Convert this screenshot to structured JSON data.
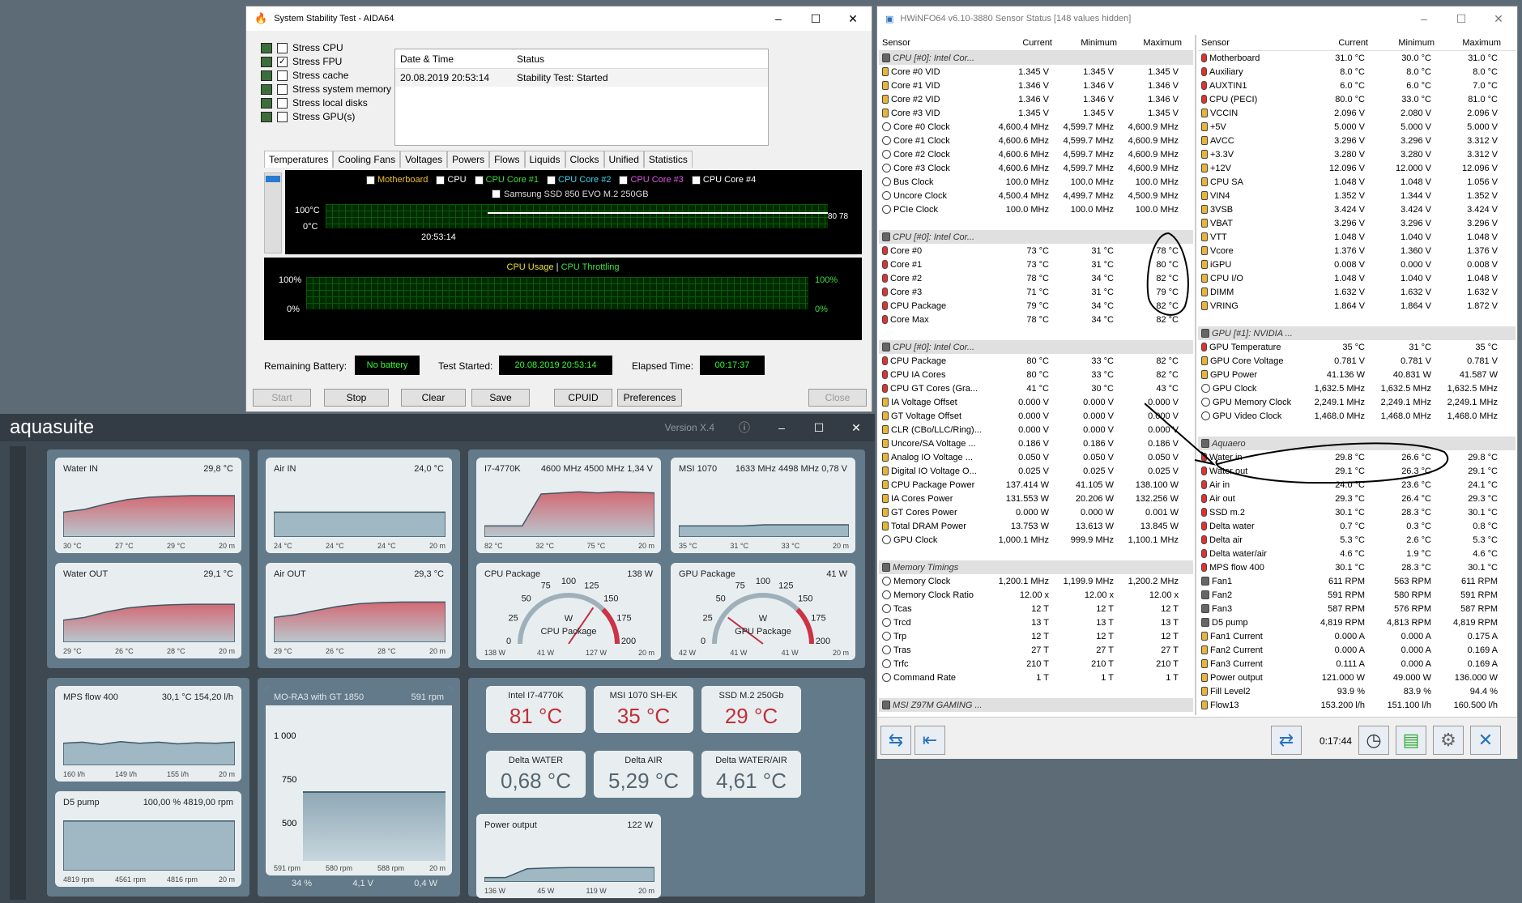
{
  "aida": {
    "title": "System Stability Test - AIDA64",
    "stress": [
      {
        "label": "Stress CPU",
        "checked": false
      },
      {
        "label": "Stress FPU",
        "checked": true
      },
      {
        "label": "Stress cache",
        "checked": false
      },
      {
        "label": "Stress system memory",
        "checked": false
      },
      {
        "label": "Stress local disks",
        "checked": false
      },
      {
        "label": "Stress GPU(s)",
        "checked": false
      }
    ],
    "table": {
      "col1": "Date & Time",
      "col2": "Status",
      "date": "20.08.2019 20:53:14",
      "status": "Stability Test: Started"
    },
    "tabs": [
      "Temperatures",
      "Cooling Fans",
      "Voltages",
      "Powers",
      "Flows",
      "Liquids",
      "Clocks",
      "Unified",
      "Statistics"
    ],
    "legend": [
      "Motherboard",
      "CPU",
      "CPU Core #1",
      "CPU Core #2",
      "CPU Core #3",
      "CPU Core #4"
    ],
    "legend2": "Samsung SSD 850 EVO M.2 250GB",
    "temp_top": "100°C",
    "temp_bottom": "0°C",
    "temp_time": "20:53:14",
    "temp_right": "80 78",
    "usage_title": "CPU Usage",
    "usage_sep": "|",
    "throttle_title": "CPU Throttling",
    "pct100": "100%",
    "pct0": "0%",
    "battery_label": "Remaining Battery:",
    "battery": "No battery",
    "started_label": "Test Started:",
    "started": "20.08.2019 20:53:14",
    "elapsed_label": "Elapsed Time:",
    "elapsed": "00:17:37",
    "buttons": {
      "start": "Start",
      "stop": "Stop",
      "clear": "Clear",
      "save": "Save",
      "cpuid": "CPUID",
      "prefs": "Preferences",
      "close": "Close"
    }
  },
  "hw": {
    "title": "HWiNFO64 v6.10-3880 Sensor Status [148 values hidden]",
    "headers": [
      "Sensor",
      "Current",
      "Minimum",
      "Maximum"
    ],
    "left": [
      [
        "g",
        "CPU [#0]: Intel Cor...",
        "",
        "",
        ""
      ],
      [
        "v",
        "Core #0 VID",
        "1.345 V",
        "1.345 V",
        "1.345 V"
      ],
      [
        "v",
        "Core #1 VID",
        "1.346 V",
        "1.346 V",
        "1.346 V"
      ],
      [
        "v",
        "Core #2 VID",
        "1.346 V",
        "1.346 V",
        "1.346 V"
      ],
      [
        "v",
        "Core #3 VID",
        "1.345 V",
        "1.345 V",
        "1.345 V"
      ],
      [
        "c",
        "Core #0 Clock",
        "4,600.4 MHz",
        "4,599.7 MHz",
        "4,600.9 MHz"
      ],
      [
        "c",
        "Core #1 Clock",
        "4,600.6 MHz",
        "4,599.7 MHz",
        "4,600.9 MHz"
      ],
      [
        "c",
        "Core #2 Clock",
        "4,600.6 MHz",
        "4,599.7 MHz",
        "4,600.9 MHz"
      ],
      [
        "c",
        "Core #3 Clock",
        "4,600.6 MHz",
        "4,599.7 MHz",
        "4,600.9 MHz"
      ],
      [
        "c",
        "Bus Clock",
        "100.0 MHz",
        "100.0 MHz",
        "100.0 MHz"
      ],
      [
        "c",
        "Uncore Clock",
        "4,500.4 MHz",
        "4,499.7 MHz",
        "4,500.9 MHz"
      ],
      [
        "c",
        "PCIe Clock",
        "100.0 MHz",
        "100.0 MHz",
        "100.0 MHz"
      ],
      [
        "s",
        "",
        "",
        "",
        ""
      ],
      [
        "g",
        "CPU [#0]: Intel Cor...",
        "",
        "",
        ""
      ],
      [
        "t",
        "Core #0",
        "73 °C",
        "31 °C",
        "78 °C"
      ],
      [
        "t",
        "Core #1",
        "73 °C",
        "31 °C",
        "80 °C"
      ],
      [
        "t",
        "Core #2",
        "78 °C",
        "34 °C",
        "82 °C"
      ],
      [
        "t",
        "Core #3",
        "71 °C",
        "31 °C",
        "79 °C"
      ],
      [
        "t",
        "CPU Package",
        "79 °C",
        "34 °C",
        "82 °C"
      ],
      [
        "t",
        "Core Max",
        "78 °C",
        "34 °C",
        "82 °C"
      ],
      [
        "s",
        "",
        "",
        "",
        ""
      ],
      [
        "g",
        "CPU [#0]: Intel Cor...",
        "",
        "",
        ""
      ],
      [
        "t",
        "CPU Package",
        "80 °C",
        "33 °C",
        "82 °C"
      ],
      [
        "t",
        "CPU IA Cores",
        "80 °C",
        "33 °C",
        "82 °C"
      ],
      [
        "t",
        "CPU GT Cores (Gra...",
        "41 °C",
        "30 °C",
        "43 °C"
      ],
      [
        "v",
        "IA Voltage Offset",
        "0.000 V",
        "0.000 V",
        "0.000 V"
      ],
      [
        "v",
        "GT Voltage Offset",
        "0.000 V",
        "0.000 V",
        "0.000 V"
      ],
      [
        "v",
        "CLR (CBo/LLC/Ring)...",
        "0.000 V",
        "0.000 V",
        "0.000 V"
      ],
      [
        "v",
        "Uncore/SA Voltage ...",
        "0.186 V",
        "0.186 V",
        "0.186 V"
      ],
      [
        "v",
        "Analog IO Voltage ...",
        "0.050 V",
        "0.050 V",
        "0.050 V"
      ],
      [
        "v",
        "Digital IO Voltage O...",
        "0.025 V",
        "0.025 V",
        "0.025 V"
      ],
      [
        "v",
        "CPU Package Power",
        "137.414 W",
        "41.105 W",
        "138.100 W"
      ],
      [
        "v",
        "IA Cores Power",
        "131.553 W",
        "20.206 W",
        "132.256 W"
      ],
      [
        "v",
        "GT Cores Power",
        "0.000 W",
        "0.000 W",
        "0.001 W"
      ],
      [
        "v",
        "Total DRAM Power",
        "13.753 W",
        "13.613 W",
        "13.845 W"
      ],
      [
        "c",
        "GPU Clock",
        "1,000.1 MHz",
        "999.9 MHz",
        "1,100.1 MHz"
      ],
      [
        "s",
        "",
        "",
        "",
        ""
      ],
      [
        "g",
        "Memory Timings",
        "",
        "",
        ""
      ],
      [
        "c",
        "Memory Clock",
        "1,200.1 MHz",
        "1,199.9 MHz",
        "1,200.2 MHz"
      ],
      [
        "c",
        "Memory Clock Ratio",
        "12.00 x",
        "12.00 x",
        "12.00 x"
      ],
      [
        "c",
        "Tcas",
        "12 T",
        "12 T",
        "12 T"
      ],
      [
        "c",
        "Trcd",
        "13 T",
        "13 T",
        "13 T"
      ],
      [
        "c",
        "Trp",
        "12 T",
        "12 T",
        "12 T"
      ],
      [
        "c",
        "Tras",
        "27 T",
        "27 T",
        "27 T"
      ],
      [
        "c",
        "Trfc",
        "210 T",
        "210 T",
        "210 T"
      ],
      [
        "c",
        "Command Rate",
        "1 T",
        "1 T",
        "1 T"
      ],
      [
        "s",
        "",
        "",
        "",
        ""
      ],
      [
        "g",
        "MSI Z97M GAMING ...",
        "",
        "",
        ""
      ]
    ],
    "right": [
      [
        "t",
        "Motherboard",
        "31.0 °C",
        "30.0 °C",
        "31.0 °C"
      ],
      [
        "t",
        "Auxiliary",
        "8.0 °C",
        "8.0 °C",
        "8.0 °C"
      ],
      [
        "t",
        "AUXTIN1",
        "6.0 °C",
        "6.0 °C",
        "7.0 °C"
      ],
      [
        "t",
        "CPU (PECI)",
        "80.0 °C",
        "33.0 °C",
        "81.0 °C"
      ],
      [
        "v",
        "VCCIN",
        "2.096 V",
        "2.080 V",
        "2.096 V"
      ],
      [
        "v",
        "+5V",
        "5.000 V",
        "5.000 V",
        "5.000 V"
      ],
      [
        "v",
        "AVCC",
        "3.296 V",
        "3.296 V",
        "3.312 V"
      ],
      [
        "v",
        "+3.3V",
        "3.280 V",
        "3.280 V",
        "3.312 V"
      ],
      [
        "v",
        "+12V",
        "12.096 V",
        "12.000 V",
        "12.096 V"
      ],
      [
        "v",
        "CPU SA",
        "1.048 V",
        "1.048 V",
        "1.056 V"
      ],
      [
        "v",
        "VIN4",
        "1.352 V",
        "1.344 V",
        "1.352 V"
      ],
      [
        "v",
        "3VSB",
        "3.424 V",
        "3.424 V",
        "3.424 V"
      ],
      [
        "v",
        "VBAT",
        "3.296 V",
        "3.296 V",
        "3.296 V"
      ],
      [
        "v",
        "VTT",
        "1.048 V",
        "1.040 V",
        "1.048 V"
      ],
      [
        "v",
        "Vcore",
        "1.376 V",
        "1.360 V",
        "1.376 V"
      ],
      [
        "v",
        "iGPU",
        "0.008 V",
        "0.000 V",
        "0.008 V"
      ],
      [
        "v",
        "CPU I/O",
        "1.048 V",
        "1.040 V",
        "1.048 V"
      ],
      [
        "v",
        "DIMM",
        "1.632 V",
        "1.632 V",
        "1.632 V"
      ],
      [
        "v",
        "VRING",
        "1.864 V",
        "1.864 V",
        "1.872 V"
      ],
      [
        "s",
        "",
        "",
        "",
        ""
      ],
      [
        "g",
        "GPU [#1]: NVIDIA ...",
        "",
        "",
        ""
      ],
      [
        "t",
        "GPU Temperature",
        "35 °C",
        "31 °C",
        "35 °C"
      ],
      [
        "v",
        "GPU Core Voltage",
        "0.781 V",
        "0.781 V",
        "0.781 V"
      ],
      [
        "v",
        "GPU Power",
        "41.136 W",
        "40.831 W",
        "41.587 W"
      ],
      [
        "c",
        "GPU Clock",
        "1,632.5 MHz",
        "1,632.5 MHz",
        "1,632.5 MHz"
      ],
      [
        "c",
        "GPU Memory Clock",
        "2,249.1 MHz",
        "2,249.1 MHz",
        "2,249.1 MHz"
      ],
      [
        "c",
        "GPU Video Clock",
        "1,468.0 MHz",
        "1,468.0 MHz",
        "1,468.0 MHz"
      ],
      [
        "s",
        "",
        "",
        "",
        ""
      ],
      [
        "g",
        "Aquaero",
        "",
        "",
        ""
      ],
      [
        "t",
        "Water in",
        "29.8 °C",
        "26.6 °C",
        "29.8 °C"
      ],
      [
        "t",
        "Water out",
        "29.1 °C",
        "26.3 °C",
        "29.1 °C"
      ],
      [
        "t",
        "Air in",
        "24.0 °C",
        "23.6 °C",
        "24.1 °C"
      ],
      [
        "t",
        "Air out",
        "29.3 °C",
        "26.4 °C",
        "29.3 °C"
      ],
      [
        "t",
        "SSD m.2",
        "30.1 °C",
        "28.3 °C",
        "30.1 °C"
      ],
      [
        "t",
        "Delta water",
        "0.7 °C",
        "0.3 °C",
        "0.8 °C"
      ],
      [
        "t",
        "Delta air",
        "5.3 °C",
        "2.6 °C",
        "5.3 °C"
      ],
      [
        "t",
        "Delta water/air",
        "4.6 °C",
        "1.9 °C",
        "4.6 °C"
      ],
      [
        "t",
        "MPS flow 400",
        "30.1 °C",
        "28.3 °C",
        "30.1 °C"
      ],
      [
        "g2",
        "Fan1",
        "611 RPM",
        "563 RPM",
        "611 RPM"
      ],
      [
        "g2",
        "Fan2",
        "591 RPM",
        "580 RPM",
        "591 RPM"
      ],
      [
        "g2",
        "Fan3",
        "587 RPM",
        "576 RPM",
        "587 RPM"
      ],
      [
        "g2",
        "D5 pump",
        "4,819 RPM",
        "4,813 RPM",
        "4,819 RPM"
      ],
      [
        "v",
        "Fan1 Current",
        "0.000 A",
        "0.000 A",
        "0.175 A"
      ],
      [
        "v",
        "Fan2 Current",
        "0.000 A",
        "0.000 A",
        "0.169 A"
      ],
      [
        "v",
        "Fan3 Current",
        "0.111 A",
        "0.000 A",
        "0.169 A"
      ],
      [
        "v",
        "Power output",
        "121.000 W",
        "49.000 W",
        "136.000 W"
      ],
      [
        "v",
        "Fill Level2",
        "93.9 %",
        "83.9 %",
        "94.4 %"
      ],
      [
        "v",
        "Flow13",
        "153.200 l/h",
        "151.100 l/h",
        "160.500 l/h"
      ]
    ],
    "timer": "0:17:44"
  },
  "aq": {
    "title": "aquasuite",
    "version": "Version X.4",
    "water_in": {
      "t": "Water IN",
      "v": "29,8 °C",
      "f": [
        "30 °C",
        "27 °C",
        "29 °C",
        "20 m"
      ]
    },
    "water_out": {
      "t": "Water OUT",
      "v": "29,1 °C",
      "f": [
        "29 °C",
        "26 °C",
        "28 °C",
        "20 m"
      ]
    },
    "air_in": {
      "t": "Air IN",
      "v": "24,0 °C",
      "f": [
        "24 °C",
        "24 °C",
        "24 °C",
        "20 m"
      ]
    },
    "air_out": {
      "t": "Air OUT",
      "v": "29,3 °C",
      "f": [
        "29 °C",
        "26 °C",
        "28 °C",
        "20 m"
      ]
    },
    "cpu": {
      "t": "I7-4770K",
      "v": "4600 MHz  4500 MHz  1,34 V",
      "f": [
        "82 °C",
        "32 °C",
        "75 °C",
        "20 m"
      ]
    },
    "gpu": {
      "t": "MSI 1070",
      "v": "1633 MHz  4498 MHz  0,78 V",
      "f": [
        "35 °C",
        "31 °C",
        "33 °C",
        "20 m"
      ]
    },
    "cpu_pkg": {
      "t": "CPU Package",
      "v": "138 W",
      "u": "W",
      "n": "CPU Package",
      "f": [
        "138 W",
        "41 W",
        "127 W",
        "20 m"
      ],
      "ticks": [
        "0",
        "25",
        "50",
        "75",
        "100",
        "125",
        "150",
        "175",
        "200"
      ],
      "level": 138
    },
    "gpu_pkg": {
      "t": "GPU Package",
      "v": "41 W",
      "u": "W",
      "n": "GPU Package",
      "f": [
        "42 W",
        "41 W",
        "41 W",
        "20 m"
      ],
      "ticks": [
        "0",
        "25",
        "50",
        "75",
        "100",
        "125",
        "150",
        "175",
        "200"
      ],
      "level": 41
    },
    "mps": {
      "t": "MPS flow 400",
      "v": "30,1 °C   154,20 l/h",
      "f": [
        "160 l/h",
        "149 l/h",
        "155 l/h",
        "20 m"
      ]
    },
    "d5": {
      "t": "D5 pump",
      "v": "100,00 %   4819,00 rpm",
      "f": [
        "4819 rpm",
        "4561 rpm",
        "4816 rpm",
        "20 m"
      ]
    },
    "mora": {
      "t": "MO-RA3 with GT 1850",
      "v": "591 rpm",
      "y": [
        "1 000",
        "750",
        "500"
      ],
      "f": [
        "591 rpm",
        "580 rpm",
        "588 rpm",
        "20 m"
      ],
      "b": [
        "34 %",
        "4,1 V",
        "0,4 W"
      ]
    },
    "big": [
      {
        "t": "Intel I7-4770K",
        "v": "81 °C"
      },
      {
        "t": "MSI 1070 SH-EK",
        "v": "35 °C"
      },
      {
        "t": "SSD M.2 250Gb",
        "v": "29 °C"
      }
    ],
    "delta": [
      {
        "t": "Delta WATER",
        "v": "0,68 °C"
      },
      {
        "t": "Delta AIR",
        "v": "5,29 °C"
      },
      {
        "t": "Delta WATER/AIR",
        "v": "4,61 °C"
      }
    ],
    "power": {
      "t": "Power output",
      "v": "122 W",
      "f": [
        "136 W",
        "45 W",
        "119 W",
        "20 m"
      ]
    }
  }
}
